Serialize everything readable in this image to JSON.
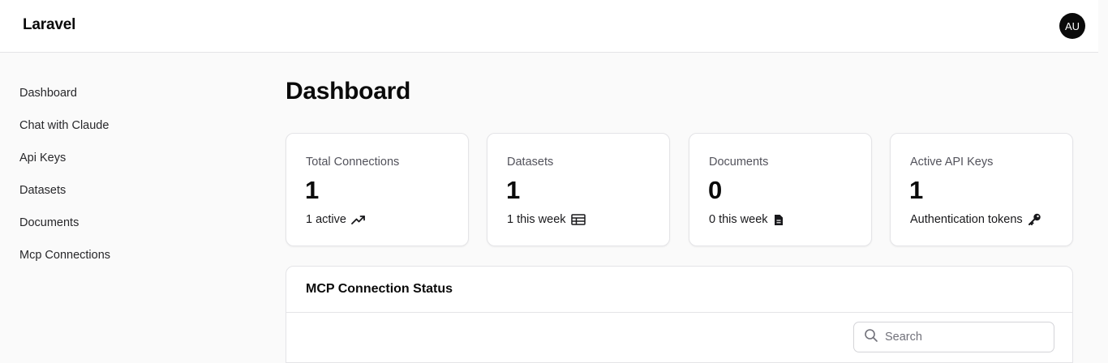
{
  "header": {
    "brand": "Laravel",
    "avatar_initials": "AU"
  },
  "sidebar": {
    "items": [
      {
        "label": "Dashboard"
      },
      {
        "label": "Chat with Claude"
      },
      {
        "label": "Api Keys"
      },
      {
        "label": "Datasets"
      },
      {
        "label": "Documents"
      },
      {
        "label": "Mcp Connections"
      }
    ]
  },
  "main": {
    "title": "Dashboard",
    "cards": [
      {
        "label": "Total Connections",
        "value": "1",
        "foot": "1 active",
        "icon": "trending-up-icon"
      },
      {
        "label": "Datasets",
        "value": "1",
        "foot": "1 this week",
        "icon": "table-icon"
      },
      {
        "label": "Documents",
        "value": "0",
        "foot": "0 this week",
        "icon": "document-icon"
      },
      {
        "label": "Active API Keys",
        "value": "1",
        "foot": "Authentication tokens",
        "icon": "key-icon"
      }
    ],
    "mcp_panel": {
      "title": "MCP Connection Status",
      "search_placeholder": "Search"
    }
  },
  "colors": {
    "background": "#fafafa",
    "surface": "#ffffff",
    "border": "#e4e4e7",
    "avatar_bg": "#0a0a0a",
    "text": "#18181b",
    "muted": "#52525b"
  }
}
